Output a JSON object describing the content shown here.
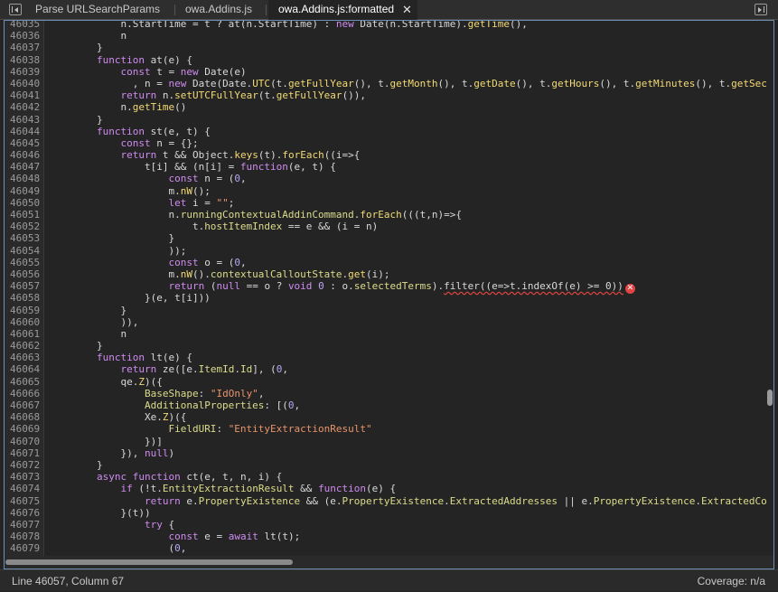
{
  "tabs": [
    {
      "label": "Parse URLSearchParams",
      "active": false
    },
    {
      "label": "owa.Addins.js",
      "active": false
    },
    {
      "label": "owa.Addins.js:formatted",
      "active": true
    }
  ],
  "close_glyph": "✕",
  "error_glyph": "✕",
  "status": {
    "position": "Line 46057, Column 67",
    "coverage": "Coverage: n/a"
  },
  "colors": {
    "keyword": "#cf8bf0",
    "function": "#f3da74",
    "string": "#e8946b",
    "number": "#b9a6f5",
    "error": "#e24444",
    "active_border": "#6d8fb3"
  },
  "code_lines": [
    {
      "ln": "46035",
      "tokens": [
        [
          "            n.StartTime = t ? at(n.StartTime) : ",
          ""
        ],
        [
          "new",
          "kw"
        ],
        [
          " Date(n.StartTime).",
          ""
        ],
        [
          "getTime",
          "fn"
        ],
        [
          "(),",
          ""
        ]
      ]
    },
    {
      "ln": "46036",
      "tokens": [
        [
          "            n",
          ""
        ]
      ]
    },
    {
      "ln": "46037",
      "tokens": [
        [
          "        }",
          ""
        ]
      ]
    },
    {
      "ln": "46038",
      "tokens": [
        [
          "        ",
          ""
        ],
        [
          "function",
          "kw"
        ],
        [
          " at(e) {",
          ""
        ]
      ]
    },
    {
      "ln": "46039",
      "tokens": [
        [
          "            ",
          ""
        ],
        [
          "const",
          "kw"
        ],
        [
          " t = ",
          ""
        ],
        [
          "new",
          "kw"
        ],
        [
          " Date(e)",
          ""
        ]
      ]
    },
    {
      "ln": "46040",
      "tokens": [
        [
          "              , n = ",
          ""
        ],
        [
          "new",
          "kw"
        ],
        [
          " Date(Date.",
          ""
        ],
        [
          "UTC",
          "fn"
        ],
        [
          "(t.",
          ""
        ],
        [
          "getFullYear",
          "fn"
        ],
        [
          "(), t.",
          ""
        ],
        [
          "getMonth",
          "fn"
        ],
        [
          "(), t.",
          ""
        ],
        [
          "getDate",
          "fn"
        ],
        [
          "(), t.",
          ""
        ],
        [
          "getHours",
          "fn"
        ],
        [
          "(), t.",
          ""
        ],
        [
          "getMinutes",
          "fn"
        ],
        [
          "(), t.",
          ""
        ],
        [
          "getSec",
          "fn"
        ]
      ]
    },
    {
      "ln": "46041",
      "tokens": [
        [
          "            ",
          ""
        ],
        [
          "return",
          "kw"
        ],
        [
          " n.",
          ""
        ],
        [
          "setUTCFullYear",
          "fn"
        ],
        [
          "(t.",
          ""
        ],
        [
          "getFullYear",
          "fn"
        ],
        [
          "()),",
          ""
        ]
      ]
    },
    {
      "ln": "46042",
      "tokens": [
        [
          "            n.",
          ""
        ],
        [
          "getTime",
          "fn"
        ],
        [
          "()",
          ""
        ]
      ]
    },
    {
      "ln": "46043",
      "tokens": [
        [
          "        }",
          ""
        ]
      ]
    },
    {
      "ln": "46044",
      "tokens": [
        [
          "        ",
          ""
        ],
        [
          "function",
          "kw"
        ],
        [
          " st(e, t) {",
          ""
        ]
      ]
    },
    {
      "ln": "46045",
      "tokens": [
        [
          "            ",
          ""
        ],
        [
          "const",
          "kw"
        ],
        [
          " n = {};",
          ""
        ]
      ]
    },
    {
      "ln": "46046",
      "tokens": [
        [
          "            ",
          ""
        ],
        [
          "return",
          "kw"
        ],
        [
          " t && Object.",
          ""
        ],
        [
          "keys",
          "fn"
        ],
        [
          "(t).",
          ""
        ],
        [
          "forEach",
          "fn"
        ],
        [
          "((i=>{",
          ""
        ]
      ]
    },
    {
      "ln": "46047",
      "tokens": [
        [
          "                t[i] && (n[i] = ",
          ""
        ],
        [
          "function",
          "kw"
        ],
        [
          "(e, t) {",
          ""
        ]
      ]
    },
    {
      "ln": "46048",
      "tokens": [
        [
          "                    ",
          ""
        ],
        [
          "const",
          "kw"
        ],
        [
          " n = (",
          ""
        ],
        [
          "0",
          "nu"
        ],
        [
          ",",
          ""
        ]
      ]
    },
    {
      "ln": "46049",
      "tokens": [
        [
          "                    m.",
          ""
        ],
        [
          "nW",
          "fn"
        ],
        [
          "();",
          ""
        ]
      ]
    },
    {
      "ln": "46050",
      "tokens": [
        [
          "                    ",
          ""
        ],
        [
          "let",
          "kw"
        ],
        [
          " i = ",
          ""
        ],
        [
          "\"\"",
          "st"
        ],
        [
          ";",
          ""
        ]
      ]
    },
    {
      "ln": "46051",
      "tokens": [
        [
          "                    n.",
          ""
        ],
        [
          "runningContextualAddinCommand",
          "pr"
        ],
        [
          ".",
          ""
        ],
        [
          "forEach",
          "fn"
        ],
        [
          "(((t,n)=>{",
          ""
        ]
      ]
    },
    {
      "ln": "46052",
      "tokens": [
        [
          "                        t.",
          ""
        ],
        [
          "hostItemIndex",
          "pr"
        ],
        [
          " == e && (i = n)",
          ""
        ]
      ]
    },
    {
      "ln": "46053",
      "tokens": [
        [
          "                    }",
          ""
        ]
      ]
    },
    {
      "ln": "46054",
      "tokens": [
        [
          "                    ));",
          ""
        ]
      ]
    },
    {
      "ln": "46055",
      "tokens": [
        [
          "                    ",
          ""
        ],
        [
          "const",
          "kw"
        ],
        [
          " o = (",
          ""
        ],
        [
          "0",
          "nu"
        ],
        [
          ",",
          ""
        ]
      ]
    },
    {
      "ln": "46056",
      "tokens": [
        [
          "                    m.",
          ""
        ],
        [
          "nW",
          "fn"
        ],
        [
          "().",
          ""
        ],
        [
          "contextualCalloutState",
          "pr"
        ],
        [
          ".",
          ""
        ],
        [
          "get",
          "fn"
        ],
        [
          "(i);",
          ""
        ]
      ]
    },
    {
      "ln": "46057",
      "tokens": [
        [
          "                    ",
          ""
        ],
        [
          "return",
          "kw"
        ],
        [
          " (",
          ""
        ],
        [
          "null",
          "kw"
        ],
        [
          " == o ? ",
          ""
        ],
        [
          "void",
          "kw"
        ],
        [
          " ",
          ""
        ],
        [
          "0",
          "nu"
        ],
        [
          " : o.",
          ""
        ],
        [
          "selectedTerms",
          "pr"
        ],
        [
          ").",
          ""
        ],
        [
          "filter((e=>t.indexOf(e) >= 0))",
          "err"
        ]
      ],
      "error": true
    },
    {
      "ln": "46058",
      "tokens": [
        [
          "                }(e, t[i]))",
          ""
        ]
      ]
    },
    {
      "ln": "46059",
      "tokens": [
        [
          "            }",
          ""
        ]
      ]
    },
    {
      "ln": "46060",
      "tokens": [
        [
          "            )),",
          ""
        ]
      ]
    },
    {
      "ln": "46061",
      "tokens": [
        [
          "            n",
          ""
        ]
      ]
    },
    {
      "ln": "46062",
      "tokens": [
        [
          "        }",
          ""
        ]
      ]
    },
    {
      "ln": "46063",
      "tokens": [
        [
          "        ",
          ""
        ],
        [
          "function",
          "kw"
        ],
        [
          " lt(e) {",
          ""
        ]
      ]
    },
    {
      "ln": "46064",
      "tokens": [
        [
          "            ",
          ""
        ],
        [
          "return",
          "kw"
        ],
        [
          " ze([e.",
          ""
        ],
        [
          "ItemId",
          "pr"
        ],
        [
          ".",
          ""
        ],
        [
          "Id",
          "pr"
        ],
        [
          "], (",
          ""
        ],
        [
          "0",
          "nu"
        ],
        [
          ",",
          ""
        ]
      ]
    },
    {
      "ln": "46065",
      "tokens": [
        [
          "            qe.",
          ""
        ],
        [
          "Z",
          "fn"
        ],
        [
          ")({",
          ""
        ]
      ]
    },
    {
      "ln": "46066",
      "tokens": [
        [
          "                ",
          ""
        ],
        [
          "BaseShape",
          "pr"
        ],
        [
          ": ",
          ""
        ],
        [
          "\"IdOnly\"",
          "st"
        ],
        [
          ",",
          ""
        ]
      ]
    },
    {
      "ln": "46067",
      "tokens": [
        [
          "                ",
          ""
        ],
        [
          "AdditionalProperties",
          "pr"
        ],
        [
          ": [(",
          ""
        ],
        [
          "0",
          "nu"
        ],
        [
          ",",
          ""
        ]
      ]
    },
    {
      "ln": "46068",
      "tokens": [
        [
          "                Xe.",
          ""
        ],
        [
          "Z",
          "fn"
        ],
        [
          ")({",
          ""
        ]
      ]
    },
    {
      "ln": "46069",
      "tokens": [
        [
          "                    ",
          ""
        ],
        [
          "FieldURI",
          "pr"
        ],
        [
          ": ",
          ""
        ],
        [
          "\"EntityExtractionResult\"",
          "st"
        ]
      ]
    },
    {
      "ln": "46070",
      "tokens": [
        [
          "                })]",
          ""
        ]
      ]
    },
    {
      "ln": "46071",
      "tokens": [
        [
          "            }), ",
          ""
        ],
        [
          "null",
          "kw"
        ],
        [
          ")",
          ""
        ]
      ]
    },
    {
      "ln": "46072",
      "tokens": [
        [
          "        }",
          ""
        ]
      ]
    },
    {
      "ln": "46073",
      "tokens": [
        [
          "        ",
          ""
        ],
        [
          "async",
          "kw"
        ],
        [
          " ",
          ""
        ],
        [
          "function",
          "kw"
        ],
        [
          " ct(e, t, n, i) {",
          ""
        ]
      ]
    },
    {
      "ln": "46074",
      "tokens": [
        [
          "            ",
          ""
        ],
        [
          "if",
          "kw"
        ],
        [
          " (!t.",
          ""
        ],
        [
          "EntityExtractionResult",
          "pr"
        ],
        [
          " && ",
          ""
        ],
        [
          "function",
          "kw"
        ],
        [
          "(e) {",
          ""
        ]
      ]
    },
    {
      "ln": "46075",
      "tokens": [
        [
          "                ",
          ""
        ],
        [
          "return",
          "kw"
        ],
        [
          " e.",
          ""
        ],
        [
          "PropertyExistence",
          "pr"
        ],
        [
          " && (e.",
          ""
        ],
        [
          "PropertyExistence",
          "pr"
        ],
        [
          ".",
          ""
        ],
        [
          "ExtractedAddresses",
          "pr"
        ],
        [
          " || e.",
          ""
        ],
        [
          "PropertyExistence",
          "pr"
        ],
        [
          ".",
          ""
        ],
        [
          "ExtractedCo",
          "pr"
        ]
      ]
    },
    {
      "ln": "46076",
      "tokens": [
        [
          "            }(t))",
          ""
        ]
      ]
    },
    {
      "ln": "46077",
      "tokens": [
        [
          "                ",
          ""
        ],
        [
          "try",
          "kw"
        ],
        [
          " {",
          ""
        ]
      ]
    },
    {
      "ln": "46078",
      "tokens": [
        [
          "                    ",
          ""
        ],
        [
          "const",
          "kw"
        ],
        [
          " e = ",
          ""
        ],
        [
          "await",
          "kw"
        ],
        [
          " lt(t);",
          ""
        ]
      ]
    },
    {
      "ln": "46079",
      "tokens": [
        [
          "                    (",
          ""
        ],
        [
          "0",
          "nu"
        ],
        [
          ",",
          ""
        ]
      ]
    }
  ]
}
